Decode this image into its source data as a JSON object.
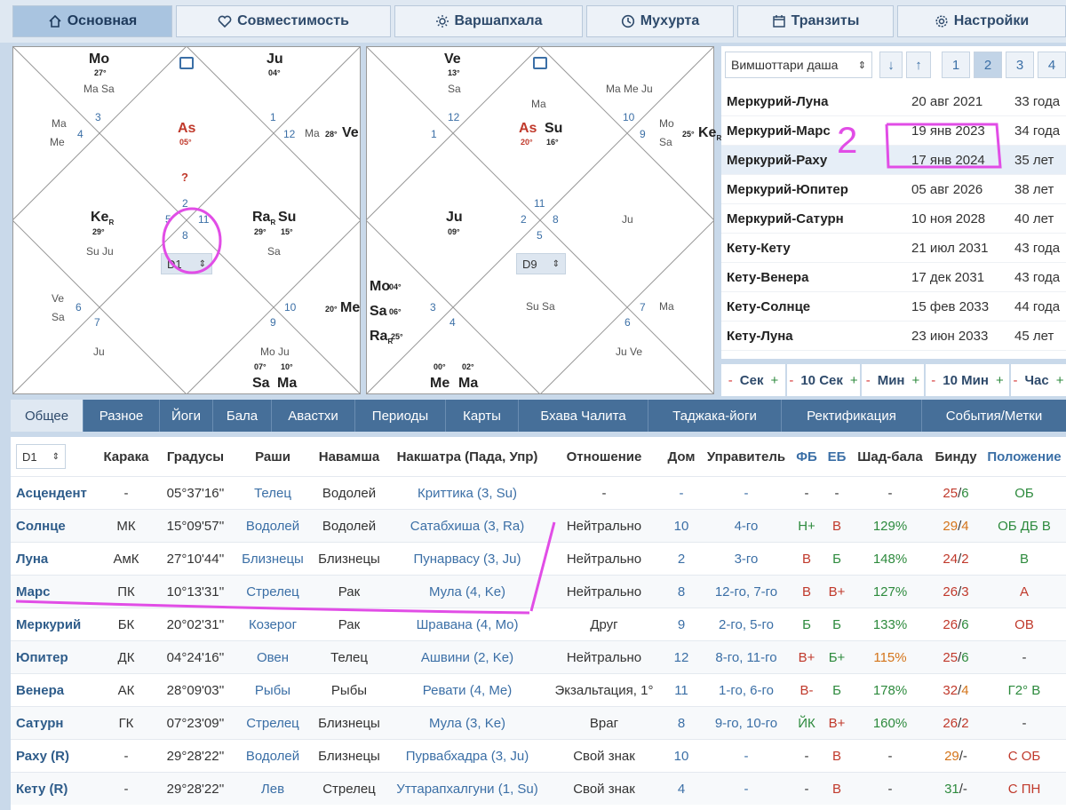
{
  "top_tabs": [
    {
      "label": "Основная",
      "icon": "home-icon"
    },
    {
      "label": "Совместимость",
      "icon": "heart-icon"
    },
    {
      "label": "Варшапхала",
      "icon": "sun-icon"
    },
    {
      "label": "Мухурта",
      "icon": "clock-icon"
    },
    {
      "label": "Транзиты",
      "icon": "calendar-icon"
    },
    {
      "label": "Настройки",
      "icon": "gear-icon"
    }
  ],
  "chart_d1": {
    "selector": "D1",
    "houses": [
      "3",
      "4",
      "1",
      "12",
      "5",
      "11",
      "2",
      "8",
      "6",
      "7",
      "10",
      "9"
    ],
    "items": [
      {
        "id": "mo",
        "planet": "Mo",
        "deg": "27°"
      },
      {
        "id": "ju",
        "planet": "Ju",
        "deg": "04°"
      },
      {
        "id": "as",
        "planet": "As",
        "deg": "05°"
      },
      {
        "id": "ke",
        "planet": "Ke",
        "sub": "R",
        "deg": "29°"
      },
      {
        "id": "ra",
        "planet": "Ra",
        "sub": "R",
        "deg": "29°"
      },
      {
        "id": "su",
        "planet": "Su",
        "deg": "15°"
      },
      {
        "id": "ve",
        "planet": "Ve",
        "deg": "28°"
      },
      {
        "id": "me",
        "planet": "Me",
        "deg": "20°"
      },
      {
        "id": "sa",
        "planet": "Sa",
        "deg": "07°"
      },
      {
        "id": "ma",
        "planet": "Ma",
        "deg": "10°"
      }
    ],
    "aspects": [
      "Ma Sa",
      "Ma",
      "Me",
      "Ma",
      "Su Ju",
      "Sa",
      "Ve",
      "Sa",
      "Ju",
      "Mo Ju",
      "?"
    ]
  },
  "chart_d9": {
    "selector": "D9",
    "houses": [
      "12",
      "10",
      "1",
      "9",
      "2",
      "8",
      "11",
      "5",
      "3",
      "7",
      "4",
      "6"
    ],
    "items": [
      {
        "id": "ve",
        "planet": "Ve",
        "deg": "13°"
      },
      {
        "id": "as",
        "planet": "As",
        "deg": "20°"
      },
      {
        "id": "su",
        "planet": "Su",
        "deg": "16°"
      },
      {
        "id": "ke",
        "planet": "Ke",
        "sub": "R",
        "deg": "25°"
      },
      {
        "id": "ju",
        "planet": "Ju",
        "deg": "09°"
      },
      {
        "id": "mo",
        "planet": "Mo",
        "deg": "04°"
      },
      {
        "id": "sa",
        "planet": "Sa",
        "deg": "06°"
      },
      {
        "id": "ra",
        "planet": "Ra",
        "sub": "R",
        "deg": "25°"
      },
      {
        "id": "me",
        "planet": "Me",
        "deg": "00°"
      },
      {
        "id": "ma",
        "planet": "Ma",
        "deg": "02°"
      }
    ],
    "aspects": [
      "Sa",
      "Ma",
      "Ma Me Ju",
      "Mo",
      "Sa",
      "Ju",
      "Su Sa",
      "Ma",
      "Ju Ve"
    ]
  },
  "dasha": {
    "selector": "Вимшоттари даша",
    "levels": [
      "1",
      "2",
      "3",
      "4"
    ],
    "rows": [
      {
        "name": "Меркурий-Луна",
        "date": "20 авг 2021",
        "age": "33 года"
      },
      {
        "name": "Меркурий-Марс",
        "date": "19 янв 2023",
        "age": "34 года"
      },
      {
        "name": "Меркурий-Раху",
        "date": "17 янв 2024",
        "age": "35 лет"
      },
      {
        "name": "Меркурий-Юпитер",
        "date": "05 авг 2026",
        "age": "38 лет"
      },
      {
        "name": "Меркурий-Сатурн",
        "date": "10 ноя 2028",
        "age": "40 лет"
      },
      {
        "name": "Кету-Кету",
        "date": "21 июл 2031",
        "age": "43 года"
      },
      {
        "name": "Кету-Венера",
        "date": "17 дек 2031",
        "age": "43 года"
      },
      {
        "name": "Кету-Солнце",
        "date": "15 фев 2033",
        "age": "44 года"
      },
      {
        "name": "Кету-Луна",
        "date": "23 июн 2033",
        "age": "45 лет"
      }
    ]
  },
  "steppers": [
    {
      "label": "Сек"
    },
    {
      "label": "10 Сек"
    },
    {
      "label": "Мин"
    },
    {
      "label": "10 Мин"
    },
    {
      "label": "Час"
    }
  ],
  "stepper_minus": "-",
  "stepper_plus": "+",
  "sub_tabs": [
    "Общее",
    "Разное",
    "Йоги",
    "Бала",
    "Авастхи",
    "Периоды",
    "Карты",
    "Бхава Чалита",
    "Таджака-йоги",
    "Ректификация",
    "События/Метки"
  ],
  "table": {
    "selector": "D1",
    "headers": [
      "Карака",
      "Градусы",
      "Раши",
      "Навамша",
      "Накшатра (Пада, Упр)",
      "Отношение",
      "Дом",
      "Управитель",
      "ФБ",
      "ЕБ",
      "Шад-бала",
      "Бинду",
      "Положение"
    ],
    "rows": [
      {
        "planet": "Асцендент",
        "karaka": "-",
        "deg": "05°37'16''",
        "rashi": "Телец",
        "navamsha": "Водолей",
        "nakshatra": "Криттика (3, Su)",
        "rel": "-",
        "house": "-",
        "lord": "-",
        "fb": "-",
        "eb": "-",
        "shad": "-",
        "bindu_a": "25",
        "bindu_b": "6",
        "pos": "ОБ"
      },
      {
        "planet": "Солнце",
        "karaka": "МК",
        "deg": "15°09'57''",
        "rashi": "Водолей",
        "navamsha": "Водолей",
        "nakshatra": "Сатабхиша (3, Ra)",
        "rel": "Нейтрально",
        "house": "10",
        "lord": "4-го",
        "fb": "Н+",
        "eb": "В",
        "shad": "129%",
        "bindu_a": "29",
        "bindu_b": "4",
        "pos": "ОБ ДБ В"
      },
      {
        "planet": "Луна",
        "karaka": "АмК",
        "deg": "27°10'44''",
        "rashi": "Близнецы",
        "navamsha": "Близнецы",
        "nakshatra": "Пунарвасу (3, Ju)",
        "rel": "Нейтрально",
        "house": "2",
        "lord": "3-го",
        "fb": "В",
        "eb": "Б",
        "shad": "148%",
        "bindu_a": "24",
        "bindu_b": "2",
        "pos": "В"
      },
      {
        "planet": "Марс",
        "karaka": "ПК",
        "deg": "10°13'31''",
        "rashi": "Стрелец",
        "navamsha": "Рак",
        "nakshatra": "Мула (4, Ke)",
        "rel": "Нейтрально",
        "house": "8",
        "lord": "12-го, 7-го",
        "fb": "В",
        "eb": "В+",
        "shad": "127%",
        "bindu_a": "26",
        "bindu_b": "3",
        "pos": "А"
      },
      {
        "planet": "Меркурий",
        "karaka": "БК",
        "deg": "20°02'31''",
        "rashi": "Козерог",
        "navamsha": "Рак",
        "nakshatra": "Шравана (4, Mo)",
        "rel": "Друг",
        "house": "9",
        "lord": "2-го, 5-го",
        "fb": "Б",
        "eb": "Б",
        "shad": "133%",
        "bindu_a": "26",
        "bindu_b": "6",
        "pos": "ОВ"
      },
      {
        "planet": "Юпитер",
        "karaka": "ДК",
        "deg": "04°24'16''",
        "rashi": "Овен",
        "navamsha": "Телец",
        "nakshatra": "Ашвини (2, Ke)",
        "rel": "Нейтрально",
        "house": "12",
        "lord": "8-го, 11-го",
        "fb": "В+",
        "eb": "Б+",
        "shad": "115%",
        "bindu_a": "25",
        "bindu_b": "6",
        "pos": "-"
      },
      {
        "planet": "Венера",
        "karaka": "АК",
        "deg": "28°09'03''",
        "rashi": "Рыбы",
        "navamsha": "Рыбы",
        "nakshatra": "Ревати (4, Me)",
        "rel": "Экзальтация, 1°",
        "house": "11",
        "lord": "1-го, 6-го",
        "fb": "В-",
        "eb": "Б",
        "shad": "178%",
        "bindu_a": "32",
        "bindu_b": "4",
        "pos": "Г2° В"
      },
      {
        "planet": "Сатурн",
        "karaka": "ГК",
        "deg": "07°23'09''",
        "rashi": "Стрелец",
        "navamsha": "Близнецы",
        "nakshatra": "Мула (3, Ke)",
        "rel": "Враг",
        "house": "8",
        "lord": "9-го, 10-го",
        "fb": "ЙК",
        "eb": "В+",
        "shad": "160%",
        "bindu_a": "26",
        "bindu_b": "2",
        "pos": "-"
      },
      {
        "planet": "Раху (R)",
        "karaka": "-",
        "deg": "29°28'22''",
        "rashi": "Водолей",
        "navamsha": "Близнецы",
        "nakshatra": "Пурвабхадра (3, Ju)",
        "rel": "Свой знак",
        "house": "10",
        "lord": "-",
        "fb": "-",
        "eb": "В",
        "shad": "-",
        "bindu_a": "29",
        "bindu_b": "-",
        "pos": "С ОБ"
      },
      {
        "planet": "Кету (R)",
        "karaka": "-",
        "deg": "29°28'22''",
        "rashi": "Лев",
        "navamsha": "Стрелец",
        "nakshatra": "Уттарапхалгуни (1, Su)",
        "rel": "Свой знак",
        "house": "4",
        "lord": "-",
        "fb": "-",
        "eb": "В",
        "shad": "-",
        "bindu_a": "31",
        "bindu_b": "-",
        "pos": "С ПН"
      }
    ]
  },
  "annotations": {
    "one": "1",
    "two": "2"
  },
  "colors": {
    "accent": "#466f99",
    "red": "#c0392b",
    "green": "#2d8a3d",
    "orange": "#d4741a",
    "annotation": "#e14de6"
  }
}
